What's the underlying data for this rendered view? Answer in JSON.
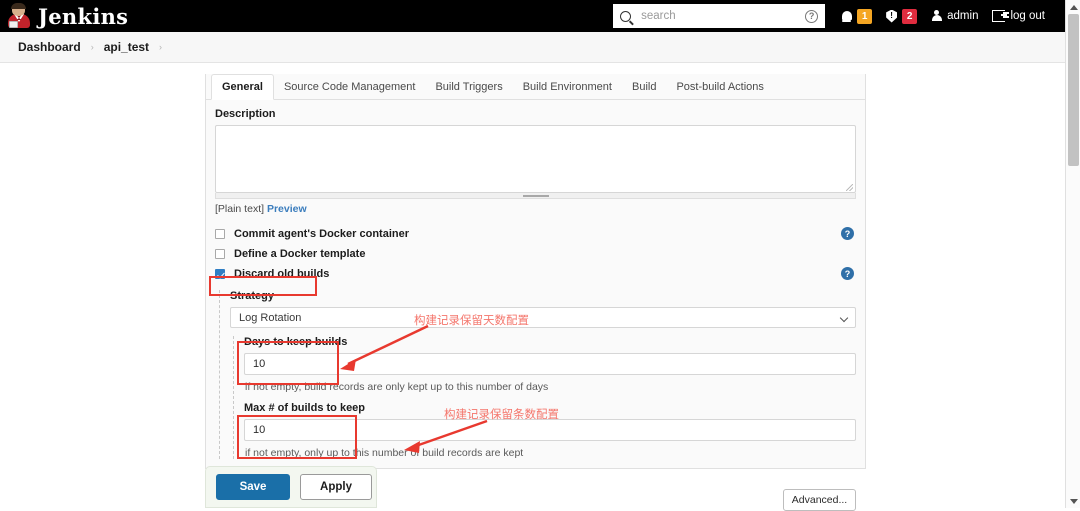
{
  "topbar": {
    "brand": "Jenkins",
    "search": {
      "placeholder": "search",
      "value": ""
    },
    "notifications_count": "1",
    "security_count": "2",
    "user": "admin",
    "logout": "log out"
  },
  "breadcrumb": {
    "items": [
      "Dashboard",
      "api_test"
    ],
    "separator": "›"
  },
  "tabs": [
    {
      "label": "General",
      "active": true
    },
    {
      "label": "Source Code Management",
      "active": false
    },
    {
      "label": "Build Triggers",
      "active": false
    },
    {
      "label": "Build Environment",
      "active": false
    },
    {
      "label": "Build",
      "active": false
    },
    {
      "label": "Post-build Actions",
      "active": false
    }
  ],
  "form": {
    "description_label": "Description",
    "description_value": "",
    "plaintext_label": "[Plain text]",
    "preview_link": "Preview",
    "checkboxes": [
      {
        "label": "Commit agent's Docker container",
        "checked": false,
        "help": true
      },
      {
        "label": "Define a Docker template",
        "checked": false,
        "help": false
      },
      {
        "label": "Discard old builds",
        "checked": true,
        "help": true
      }
    ],
    "strategy_label": "Strategy",
    "strategy_value": "Log Rotation",
    "days_label": "Days to keep builds",
    "days_value": "10",
    "days_hint": "if not empty, build records are only kept up to this number of days",
    "max_label": "Max # of builds to keep",
    "max_value": "10",
    "max_hint": "if not empty, only up to this number of build records are kept",
    "advanced_button": "Advanced..."
  },
  "annotations": [
    {
      "text": "构建记录保留天数配置"
    },
    {
      "text": "构建记录保留条数配置"
    }
  ],
  "actions": {
    "save": "Save",
    "apply": "Apply"
  },
  "colors": {
    "topbar_bg": "#000000",
    "primary_button": "#1a6fa8",
    "badge_orange": "#f5a623",
    "badge_red": "#e02c3f",
    "annotation_red": "#e8392f",
    "help_blue": "#2f6fa8"
  }
}
